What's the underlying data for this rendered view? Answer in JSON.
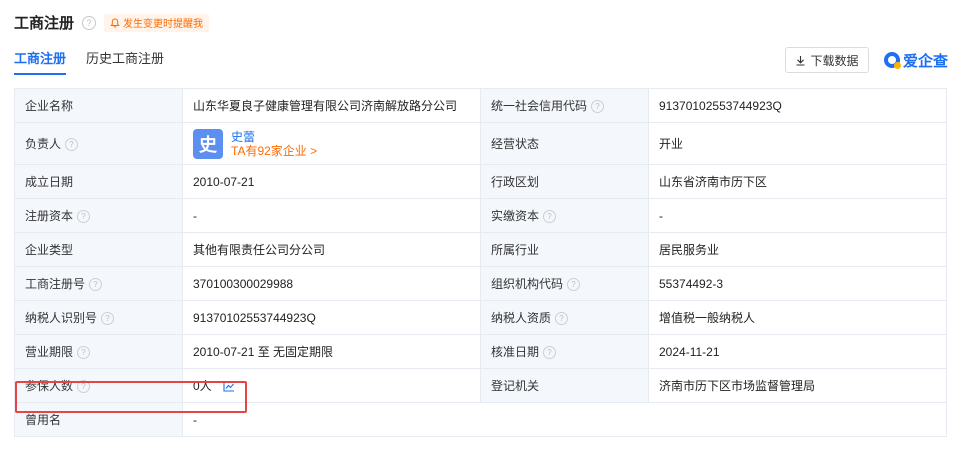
{
  "header": {
    "title": "工商注册",
    "reminder": "发生变更时提醒我"
  },
  "tabs": [
    {
      "label": "工商注册",
      "active": true
    },
    {
      "label": "历史工商注册",
      "active": false
    }
  ],
  "toolbar": {
    "download_label": "下载数据",
    "brand": "爱企查"
  },
  "rows": [
    {
      "l1": "企业名称",
      "v1": "山东华夏良子健康管理有限公司济南解放路分公司",
      "l2": "统一社会信用代码",
      "v2": "91370102553744923Q"
    },
    {
      "l1": "负责人",
      "person_name": "史蕾",
      "person_avatar": "史",
      "person_link": "TA有92家企业 >",
      "l2": "经营状态",
      "v2": "开业"
    },
    {
      "l1": "成立日期",
      "v1": "2010-07-21",
      "l2": "行政区划",
      "v2": "山东省济南市历下区"
    },
    {
      "l1": "注册资本",
      "v1": "-",
      "l2": "实缴资本",
      "v2": "-"
    },
    {
      "l1": "企业类型",
      "v1": "其他有限责任公司分公司",
      "l2": "所属行业",
      "v2": "居民服务业"
    },
    {
      "l1": "工商注册号",
      "v1": "370100300029988",
      "l2": "组织机构代码",
      "v2": "55374492-3"
    },
    {
      "l1": "纳税人识别号",
      "v1": "91370102553744923Q",
      "l2": "纳税人资质",
      "v2": "增值税一般纳税人"
    },
    {
      "l1": "营业期限",
      "v1": "2010-07-21 至 无固定期限",
      "l2": "核准日期",
      "v2": "2024-11-21"
    },
    {
      "l1": "参保人数",
      "v1": "0人",
      "l2": "登记机关",
      "v2": "济南市历下区市场监督管理局"
    },
    {
      "l1": "曾用名",
      "v1": "-"
    }
  ],
  "colors": {
    "accent": "#1e6ff1",
    "warning": "#ff6a00",
    "highlight": "#e54545",
    "label_bg": "#f4f7fc"
  }
}
